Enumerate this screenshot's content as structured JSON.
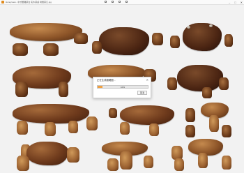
{
  "window": {
    "title": "Honeyview - 中式根雕茶台 实木茶桌 树根茶几.jpg",
    "icon": "honeyview-app-icon",
    "controls": {
      "minimize": "–",
      "maximize": "□",
      "close": "✕"
    }
  },
  "toolbar": {
    "icons": [
      "open-icon",
      "rotate-icon",
      "zoom-icon",
      "fullscreen-icon"
    ]
  },
  "dialog": {
    "title": "正在生成缩略图...",
    "progress_percent": 10,
    "progress_label": "10%",
    "close_label": "✕",
    "cancel_label": "取消"
  },
  "colors": {
    "accent": "#f0a040",
    "wood_dark": "#4a2412",
    "wood_light": "#c58a4e",
    "background": "#f2f2f2"
  }
}
